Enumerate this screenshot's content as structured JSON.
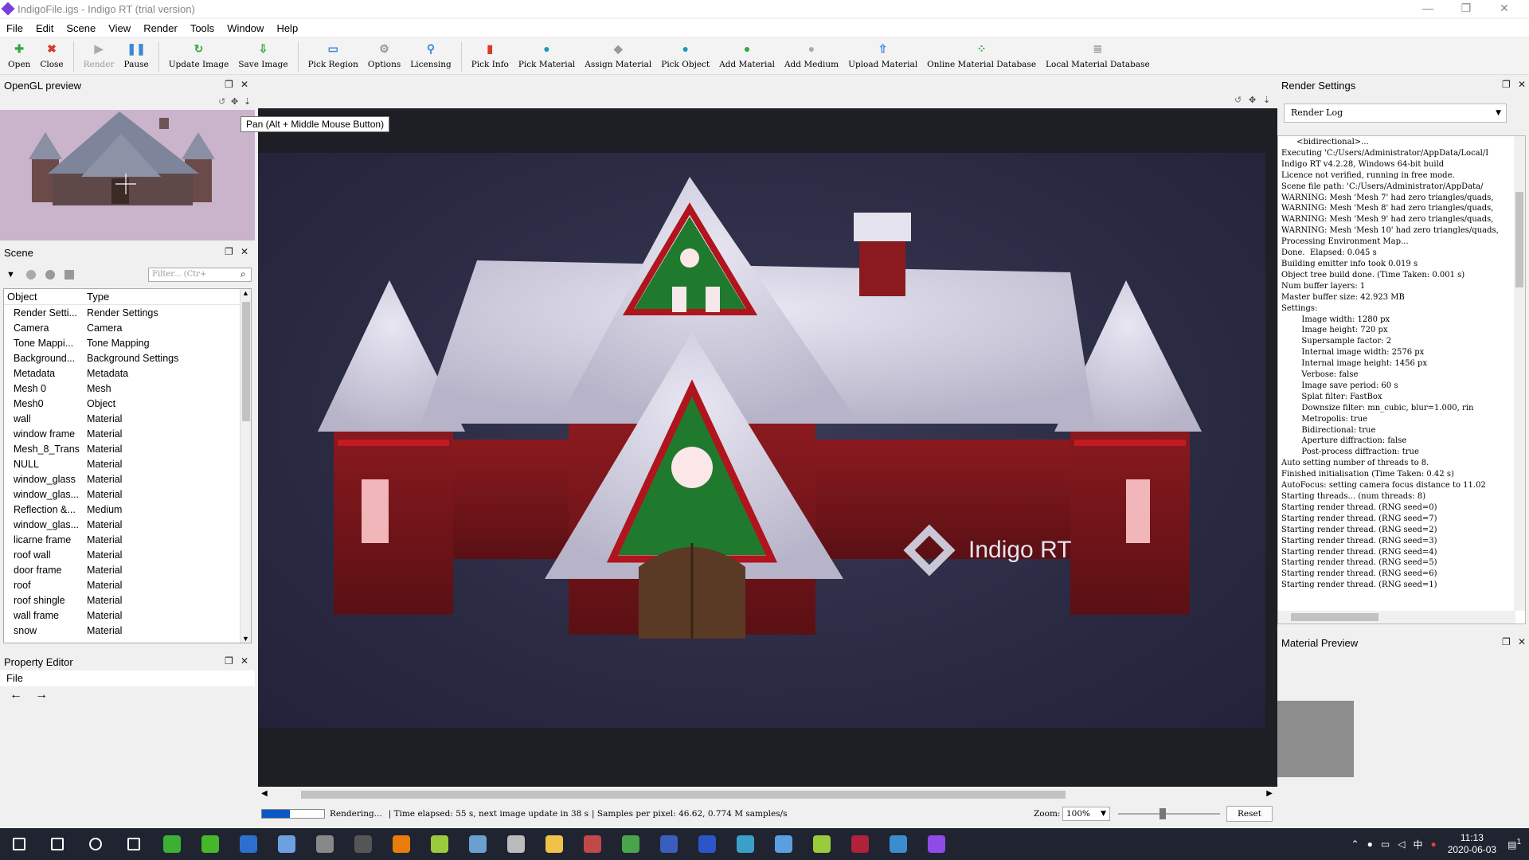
{
  "window": {
    "title": "IndigoFile.igs - Indigo RT (trial version)",
    "minimize": "—",
    "maximize": "❐",
    "close": "✕"
  },
  "menu": [
    "File",
    "Edit",
    "Scene",
    "View",
    "Render",
    "Tools",
    "Window",
    "Help"
  ],
  "toolbar": [
    {
      "label": "Open",
      "icon": "plus-icon",
      "color": "#2eaa3d"
    },
    {
      "label": "Close",
      "icon": "close-icon",
      "color": "#d43c2c"
    },
    {
      "label": "Render",
      "icon": "play-icon",
      "color": "#aaaaaa",
      "disabled": true
    },
    {
      "label": "Pause",
      "icon": "pause-icon",
      "color": "#3b88d6"
    },
    {
      "label": "Update Image",
      "icon": "refresh-icon",
      "color": "#2eaa3d"
    },
    {
      "label": "Save Image",
      "icon": "save-image-icon",
      "color": "#2eaa3d"
    },
    {
      "label": "Pick Region",
      "icon": "region-icon",
      "color": "#3b88d6"
    },
    {
      "label": "Options",
      "icon": "gear-icon",
      "color": "#999999"
    },
    {
      "label": "Licensing",
      "icon": "key-icon",
      "color": "#3b88d6"
    },
    {
      "label": "Pick Info",
      "icon": "chart-icon",
      "color": "#d43c2c"
    },
    {
      "label": "Pick Material",
      "icon": "material-picker-icon",
      "color": "#1b9bb5"
    },
    {
      "label": "Assign Material",
      "icon": "assign-icon",
      "color": "#999999"
    },
    {
      "label": "Pick Object",
      "icon": "object-picker-icon",
      "color": "#1b9bb5"
    },
    {
      "label": "Add Material",
      "icon": "add-material-icon",
      "color": "#2eaa3d"
    },
    {
      "label": "Add Medium",
      "icon": "add-medium-icon",
      "color": "#aaaaaa"
    },
    {
      "label": "Upload Material",
      "icon": "upload-icon",
      "color": "#3b88d6"
    },
    {
      "label": "Online Material Database",
      "icon": "database-icon",
      "color": "#2eaa3d"
    },
    {
      "label": "Local Material Database",
      "icon": "local-db-icon",
      "color": "#999999"
    }
  ],
  "panels": {
    "opengl": "OpenGL preview",
    "scene": "Scene",
    "property": "Property Editor",
    "render_settings": "Render Settings",
    "material_preview": "Material Preview"
  },
  "scene": {
    "filter_placeholder": "Filter... (Ctr+",
    "columns": [
      "Object",
      "Type"
    ],
    "rows": [
      [
        "Render Setti...",
        "Render Settings"
      ],
      [
        "Camera",
        "Camera"
      ],
      [
        "Tone Mappi...",
        "Tone Mapping"
      ],
      [
        "Background...",
        "Background Settings"
      ],
      [
        "Metadata",
        "Metadata"
      ],
      [
        "Mesh 0",
        "Mesh"
      ],
      [
        "Mesh0",
        "Object"
      ],
      [
        "wall",
        "Material"
      ],
      [
        "window frame",
        "Material"
      ],
      [
        "Mesh_8_Trans",
        "Material"
      ],
      [
        "NULL",
        "Material"
      ],
      [
        "window_glass",
        "Material"
      ],
      [
        "window_glas...",
        "Material"
      ],
      [
        "Reflection &...",
        "Medium"
      ],
      [
        "window_glas...",
        "Material"
      ],
      [
        "licarne frame",
        "Material"
      ],
      [
        "roof wall",
        "Material"
      ],
      [
        "door frame",
        "Material"
      ],
      [
        "roof",
        "Material"
      ],
      [
        "roof shingle",
        "Material"
      ],
      [
        "wall frame",
        "Material"
      ],
      [
        "snow",
        "Material"
      ]
    ]
  },
  "property": {
    "file": "File",
    "back": "←",
    "forward": "→"
  },
  "tooltip": "Pan (Alt + Middle Mouse Button)",
  "render_settings": {
    "selected": "Render Log",
    "log": [
      "      <bidirectional>...",
      "Executing 'C:/Users/Administrator/AppData/Local/I",
      "Indigo RT v4.2.28, Windows 64-bit build",
      "Licence not verified, running in free mode.",
      "Scene file path: 'C:/Users/Administrator/AppData/",
      "WARNING: Mesh 'Mesh 7' had zero triangles/quads,",
      "WARNING: Mesh 'Mesh 8' had zero triangles/quads,",
      "WARNING: Mesh 'Mesh 9' had zero triangles/quads,",
      "WARNING: Mesh 'Mesh 10' had zero triangles/quads,",
      "Processing Environment Map...",
      "Done.  Elapsed: 0.045 s",
      "Building emitter info took 0.019 s",
      "Object tree build done. (Time Taken: 0.001 s)",
      "Num buffer layers: 1",
      "Master buffer size: 42.923 MB",
      "Settings:",
      "        Image width: 1280 px",
      "        Image height: 720 px",
      "        Supersample factor: 2",
      "        Internal image width: 2576 px",
      "        Internal image height: 1456 px",
      "        Verbose: false",
      "        Image save period: 60 s",
      "        Splat filter: FastBox",
      "        Downsize filter: mn_cubic, blur=1.000, rin",
      "        Metropolis: true",
      "        Bidirectional: true",
      "        Aperture diffraction: false",
      "        Post-process diffraction: true",
      "Auto setting number of threads to 8.",
      "Finished initialisation (Time Taken: 0.42 s)",
      "AutoFocus: setting camera focus distance to 11.02",
      "Starting threads... (num threads: 8)",
      "Starting render thread. (RNG seed=0)",
      "Starting render thread. (RNG seed=7)",
      "Starting render thread. (RNG seed=2)",
      "Starting render thread. (RNG seed=3)",
      "Starting render thread. (RNG seed=4)",
      "Starting render thread. (RNG seed=5)",
      "Starting render thread. (RNG seed=6)",
      "Starting render thread. (RNG seed=1)"
    ]
  },
  "status": {
    "progress": 0.45,
    "state": "Rendering...",
    "elapsed": "| Time elapsed: 55 s, next image update in 38 s",
    "samples": "| Samples per pixel: 46.62, 0.774 M samples/s",
    "zoom_label": "Zoom:",
    "zoom_value": "100%",
    "reset": "Reset"
  },
  "watermark": "Indigo RT",
  "taskbar": {
    "icons": [
      {
        "name": "start-icon",
        "color": "#ffffff"
      },
      {
        "name": "search-icon",
        "color": "#ffffff"
      },
      {
        "name": "cortana-icon",
        "color": "#ffffff"
      },
      {
        "name": "task-view-icon",
        "color": "#ffffff"
      },
      {
        "name": "app-green-icon",
        "color": "#3cb034"
      },
      {
        "name": "app-x-icon",
        "color": "#45b82a"
      },
      {
        "name": "app-blue-icon",
        "color": "#2d6fd1"
      },
      {
        "name": "app-bird-icon",
        "color": "#6ea0e0"
      },
      {
        "name": "app-rr-icon",
        "color": "#888888"
      },
      {
        "name": "app-obs-icon",
        "color": "#555555"
      },
      {
        "name": "blender-icon",
        "color": "#e87d0d"
      },
      {
        "name": "app-diamond-icon",
        "color": "#9acb3c"
      },
      {
        "name": "app-grid-icon",
        "color": "#6aa0d0"
      },
      {
        "name": "app-cloud-icon",
        "color": "#bbbbbb"
      },
      {
        "name": "file-explorer-icon",
        "color": "#f0c24a"
      },
      {
        "name": "app-avatar-icon",
        "color": "#c04848"
      },
      {
        "name": "chrome-icon",
        "color": "#4aa54a"
      },
      {
        "name": "app-n-icon",
        "color": "#3b5dbd"
      },
      {
        "name": "app-n2-icon",
        "color": "#2b55c8"
      },
      {
        "name": "app-monitor-icon",
        "color": "#3aa0c8"
      },
      {
        "name": "app-circle-icon",
        "color": "#5aa0e0"
      },
      {
        "name": "app-diamond2-icon",
        "color": "#9acb3c"
      },
      {
        "name": "app-a-icon",
        "color": "#b0223a"
      },
      {
        "name": "app-photo-icon",
        "color": "#3a8ed0"
      },
      {
        "name": "indigo-icon",
        "color": "#8e4be8"
      }
    ],
    "tray_ime": "中",
    "time": "11:13",
    "date": "2020-06-03",
    "notifications": "1"
  }
}
